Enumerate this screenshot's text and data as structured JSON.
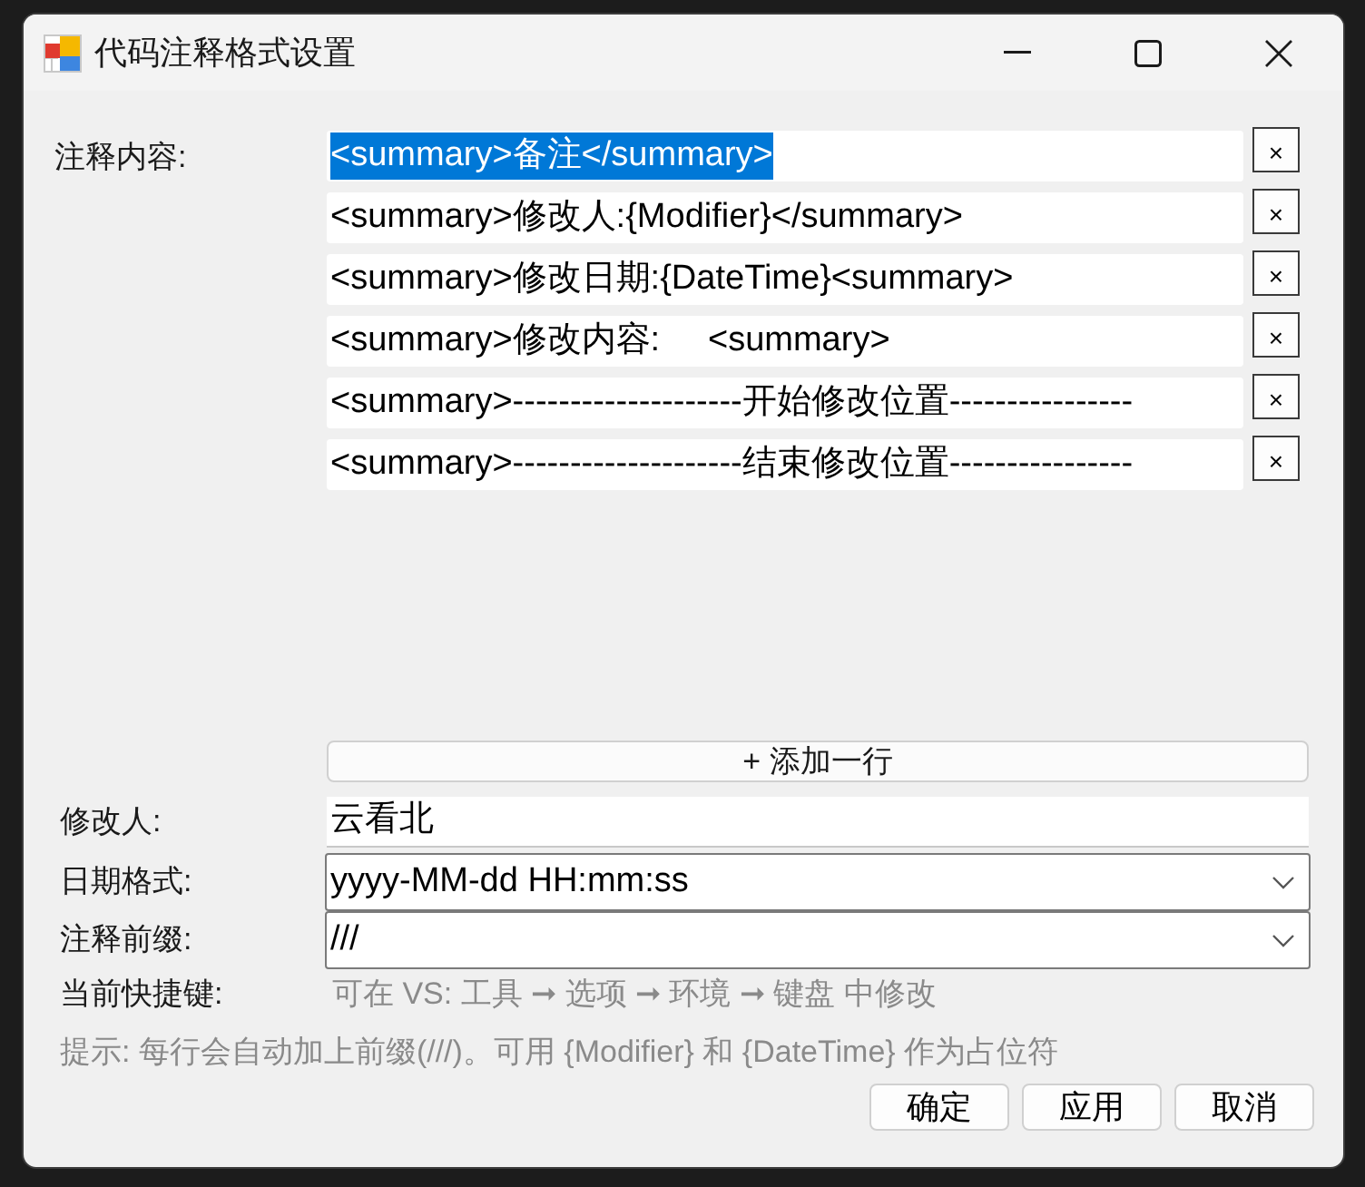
{
  "window": {
    "title": "代码注释格式设置"
  },
  "comment_content": {
    "label": "注释内容:",
    "lines": [
      {
        "text": "<summary>备注</summary>",
        "selected": true,
        "delete_button": "×"
      },
      {
        "text": "<summary>修改人:{Modifier}</summary>",
        "selected": false,
        "delete_button": "×"
      },
      {
        "text": "<summary>修改日期:{DateTime}<summary>",
        "selected": false,
        "delete_button": "×"
      },
      {
        "text": "<summary>修改内容:     <summary>",
        "selected": false,
        "delete_button": "×"
      },
      {
        "text": "<summary>--------------------开始修改位置----------------",
        "selected": false,
        "delete_button": "×"
      },
      {
        "text": "<summary>--------------------结束修改位置----------------",
        "selected": false,
        "delete_button": "×"
      }
    ]
  },
  "add_line_button": "+ 添加一行",
  "fields": [
    {
      "kind": "text",
      "label": "修改人:",
      "value": "云看北"
    },
    {
      "kind": "combo",
      "label": "日期格式:",
      "value": "yyyy-MM-dd HH:mm:ss"
    },
    {
      "kind": "combo",
      "label": "注释前缀:",
      "value": "///"
    },
    {
      "kind": "info",
      "label": "当前快捷键:",
      "value": "可在 VS: 工具 ➞ 选项 ➞ 环境 ➞ 键盘 中修改"
    }
  ],
  "hint": "提示: 每行会自动加上前缀(///)。可用 {Modifier} 和 {DateTime} 作为占位符",
  "buttons": [
    "确定",
    "应用",
    "取消"
  ]
}
